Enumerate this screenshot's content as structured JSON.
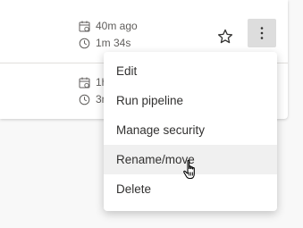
{
  "rows": [
    {
      "time_ago": "40m ago",
      "duration": "1m 34s"
    },
    {
      "time_ago": "1h",
      "duration": "3m"
    }
  ],
  "icons": {
    "calendar": "calendar-icon",
    "clock": "clock-icon",
    "star": "star-icon",
    "more": "more-vertical-icon",
    "cursor": "hand-pointer-icon"
  },
  "menu": {
    "items": [
      {
        "label": "Edit"
      },
      {
        "label": "Run pipeline"
      },
      {
        "label": "Manage security"
      },
      {
        "label": "Rename/move"
      },
      {
        "label": "Delete"
      }
    ],
    "hovered_item": "Rename/move"
  },
  "colors": {
    "text": "#323130",
    "meta_text": "#605e5c",
    "hover_bg": "#f0f0f0",
    "more_button_bg": "#dddddd"
  }
}
